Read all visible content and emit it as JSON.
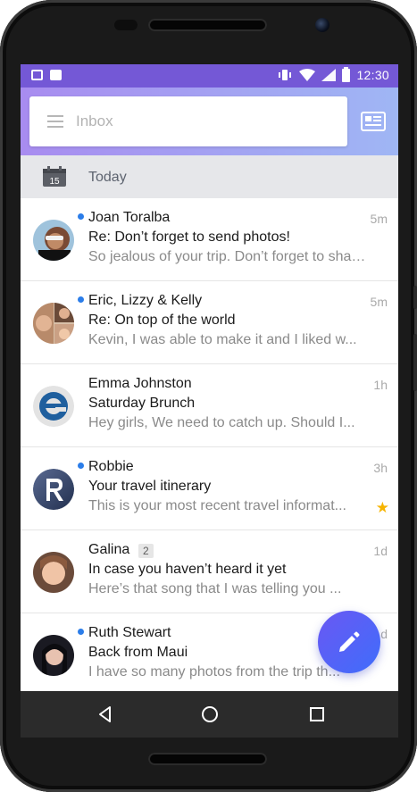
{
  "status_bar": {
    "time": "12:30"
  },
  "search": {
    "placeholder": "Inbox"
  },
  "section": {
    "label": "Today",
    "calendar_day": "15"
  },
  "emails": [
    {
      "from": "Joan Toralba",
      "subject": "Re: Don’t forget to send photos!",
      "preview": "So jealous of your trip. Don’t forget to shar...",
      "time": "5m",
      "unread": true
    },
    {
      "from": "Eric, Lizzy & Kelly",
      "subject": "Re: On top of the world",
      "preview": "Kevin, I was able to make it and I liked w...",
      "time": "5m",
      "unread": true
    },
    {
      "from": "Emma Johnston",
      "subject": "Saturday Brunch",
      "preview": "Hey girls, We need to catch up. Should I...",
      "time": "1h",
      "unread": false
    },
    {
      "from": "Robbie",
      "subject": "Your travel itinerary",
      "preview": "This is your most recent travel informat...",
      "time": "3h",
      "unread": true,
      "starred": true
    },
    {
      "from": "Galina",
      "subject": "In case you haven’t heard it yet",
      "preview": "Here’s that song that I was telling you ...",
      "time": "1d",
      "unread": false,
      "count": "2"
    },
    {
      "from": "Ruth Stewart",
      "subject": "Back from Maui",
      "preview": "I have so many photos from the trip th...",
      "time": "1d",
      "unread": true
    }
  ],
  "colors": {
    "status_bar": "#7458d6",
    "unread_dot": "#2b7de9",
    "star": "#f6b400",
    "fab": "#5a62f6"
  },
  "icons": {
    "menu": "hamburger-icon",
    "compose_card": "newspaper-icon",
    "calendar": "calendar-icon",
    "fab": "pencil-icon",
    "nav": [
      "back-icon",
      "home-icon",
      "recents-icon"
    ]
  }
}
